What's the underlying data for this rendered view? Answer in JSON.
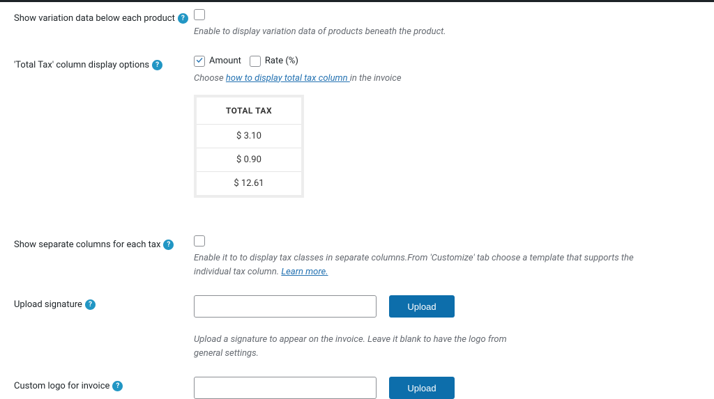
{
  "rows": {
    "variation": {
      "label": "Show variation data below each product",
      "checked": false,
      "description": "Enable to display variation data of products beneath the product."
    },
    "total_tax": {
      "label": "'Total Tax' column display options",
      "amount_label": "Amount",
      "amount_checked": true,
      "rate_label": "Rate (%)",
      "rate_checked": false,
      "desc_prefix": "Choose ",
      "desc_link": "how to display total tax column ",
      "desc_suffix": "in the invoice",
      "table_header": "TOTAL TAX",
      "table_rows": [
        "$ 3.10",
        "$ 0.90",
        "$ 12.61"
      ]
    },
    "separate_cols": {
      "label": "Show separate columns for each tax",
      "checked": false,
      "desc_text": "Enable it to to display tax classes in separate columns.From 'Customize' tab choose a template that supports the individual tax column. ",
      "learn_more": "Learn more."
    },
    "signature": {
      "label": "Upload signature",
      "button": "Upload",
      "description": "Upload a signature to appear on the invoice. Leave it blank to have the logo from general settings."
    },
    "custom_logo": {
      "label": "Custom logo for invoice",
      "button": "Upload"
    }
  },
  "help_icon": "?"
}
